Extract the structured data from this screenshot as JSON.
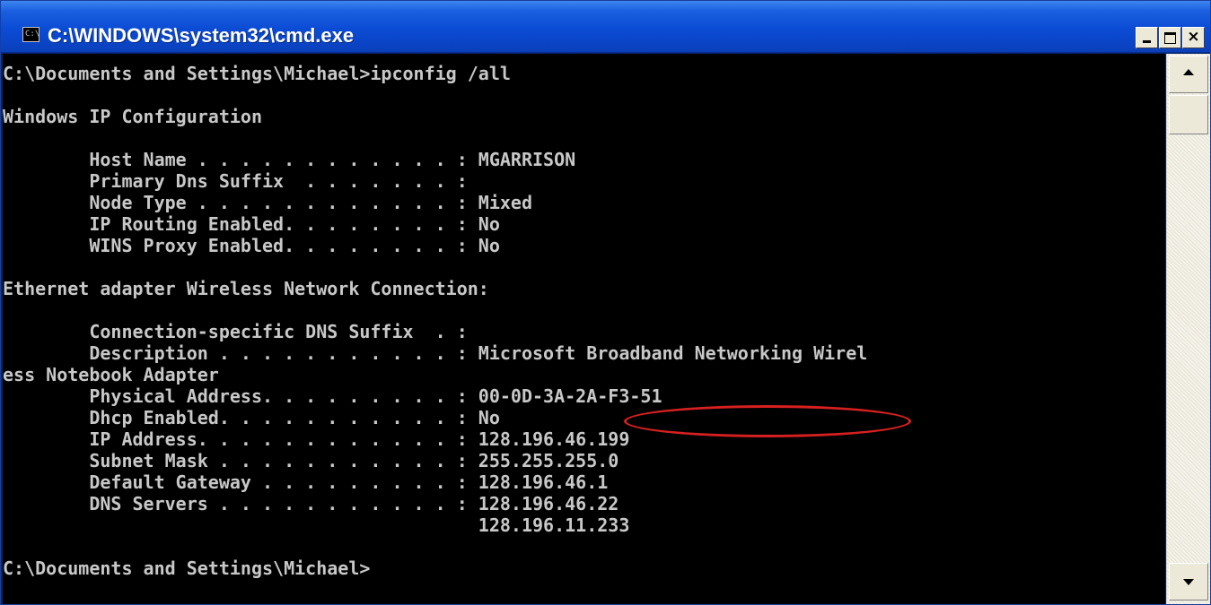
{
  "window": {
    "title": "C:\\WINDOWS\\system32\\cmd.exe",
    "icon_text": "C:\\",
    "buttons": {
      "minimize": "_",
      "maximize": "□",
      "close": "×"
    }
  },
  "console": {
    "lines": [
      "C:\\Documents and Settings\\Michael>ipconfig /all",
      "",
      "Windows IP Configuration",
      "",
      "        Host Name . . . . . . . . . . . . : MGARRISON",
      "        Primary Dns Suffix  . . . . . . . :",
      "        Node Type . . . . . . . . . . . . : Mixed",
      "        IP Routing Enabled. . . . . . . . : No",
      "        WINS Proxy Enabled. . . . . . . . : No",
      "",
      "Ethernet adapter Wireless Network Connection:",
      "",
      "        Connection-specific DNS Suffix  . :",
      "        Description . . . . . . . . . . . : Microsoft Broadband Networking Wirel",
      "ess Notebook Adapter",
      "        Physical Address. . . . . . . . . : 00-0D-3A-2A-F3-51",
      "        Dhcp Enabled. . . . . . . . . . . : No",
      "        IP Address. . . . . . . . . . . . : 128.196.46.199",
      "        Subnet Mask . . . . . . . . . . . : 255.255.255.0",
      "        Default Gateway . . . . . . . . . : 128.196.46.1",
      "        DNS Servers . . . . . . . . . . . : 128.196.46.22",
      "                                            128.196.11.233",
      "",
      "C:\\Documents and Settings\\Michael>"
    ]
  },
  "colors": {
    "console_bg": "#000000",
    "console_text": "#c8c8c8",
    "highlight": "#d82020",
    "titlebar": "#0b4bd4"
  }
}
